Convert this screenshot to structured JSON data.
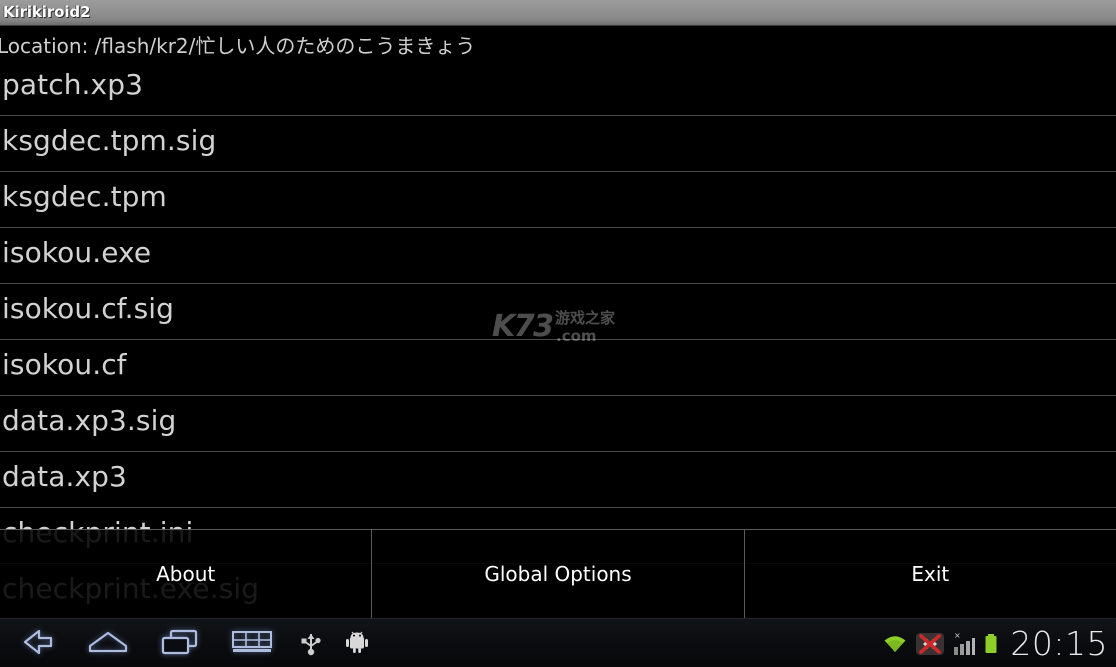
{
  "titlebar": {
    "app_title": "Kirikiroid2"
  },
  "location": {
    "text": "Location: /flash/kr2/忙しい人のためのこうまきょう"
  },
  "filelist": {
    "items": [
      {
        "name": "patch.xp3"
      },
      {
        "name": "ksgdec.tpm.sig"
      },
      {
        "name": "ksgdec.tpm"
      },
      {
        "name": "isokou.exe"
      },
      {
        "name": "isokou.cf.sig"
      },
      {
        "name": "isokou.cf"
      },
      {
        "name": "data.xp3.sig"
      },
      {
        "name": "data.xp3"
      },
      {
        "name": "checkprint.ini"
      },
      {
        "name": "checkprint.exe.sig"
      }
    ]
  },
  "menu": {
    "items": [
      {
        "label": "About"
      },
      {
        "label": "Global Options"
      },
      {
        "label": "Exit"
      }
    ]
  },
  "watermark": {
    "logo": "K73",
    "chinese": "游戏之家",
    "domain": ".com"
  },
  "navbar": {
    "buttons": [
      {
        "icon": "back-icon"
      },
      {
        "icon": "home-icon"
      },
      {
        "icon": "recent-apps-icon"
      },
      {
        "icon": "keyboard-icon"
      },
      {
        "icon": "usb-icon"
      },
      {
        "icon": "android-robot-icon"
      }
    ],
    "status": {
      "wifi": "wifi-icon",
      "data_disabled": "data-off-icon",
      "signal": "signal-bars-icon",
      "battery": "battery-icon",
      "clock": "20:15"
    }
  },
  "colors": {
    "titlebar_top": "#9c9c9c",
    "titlebar_bottom": "#6e6e6e",
    "background": "#000000",
    "list_text": "#d2d2d2",
    "separator": "#4a4a4a",
    "menu_text": "#ffffff",
    "wifi_green": "#8fcd28",
    "battery_green": "#8fcd28",
    "data_red": "#cc2a2a",
    "nav_icon_blue": "#aebce0",
    "clock_text": "#e8e8e8"
  }
}
